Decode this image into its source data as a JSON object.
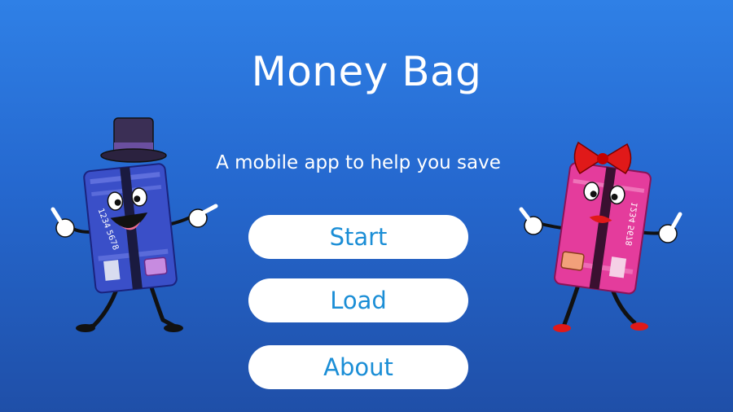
{
  "app": {
    "title": "Money Bag",
    "subtitle": "A mobile app to help you save"
  },
  "menu": {
    "start_label": "Start",
    "load_label": "Load",
    "about_label": "About"
  },
  "mascots": {
    "left_card_number": "1234 5678",
    "right_card_number": "1234 5678"
  },
  "colors": {
    "background_top": "#2f80e6",
    "background_bottom": "#1f4fa8",
    "button_bg": "#ffffff",
    "button_text": "#1b8ed6",
    "blue_card": "#3a4fc8",
    "pink_card": "#e43c9c"
  }
}
